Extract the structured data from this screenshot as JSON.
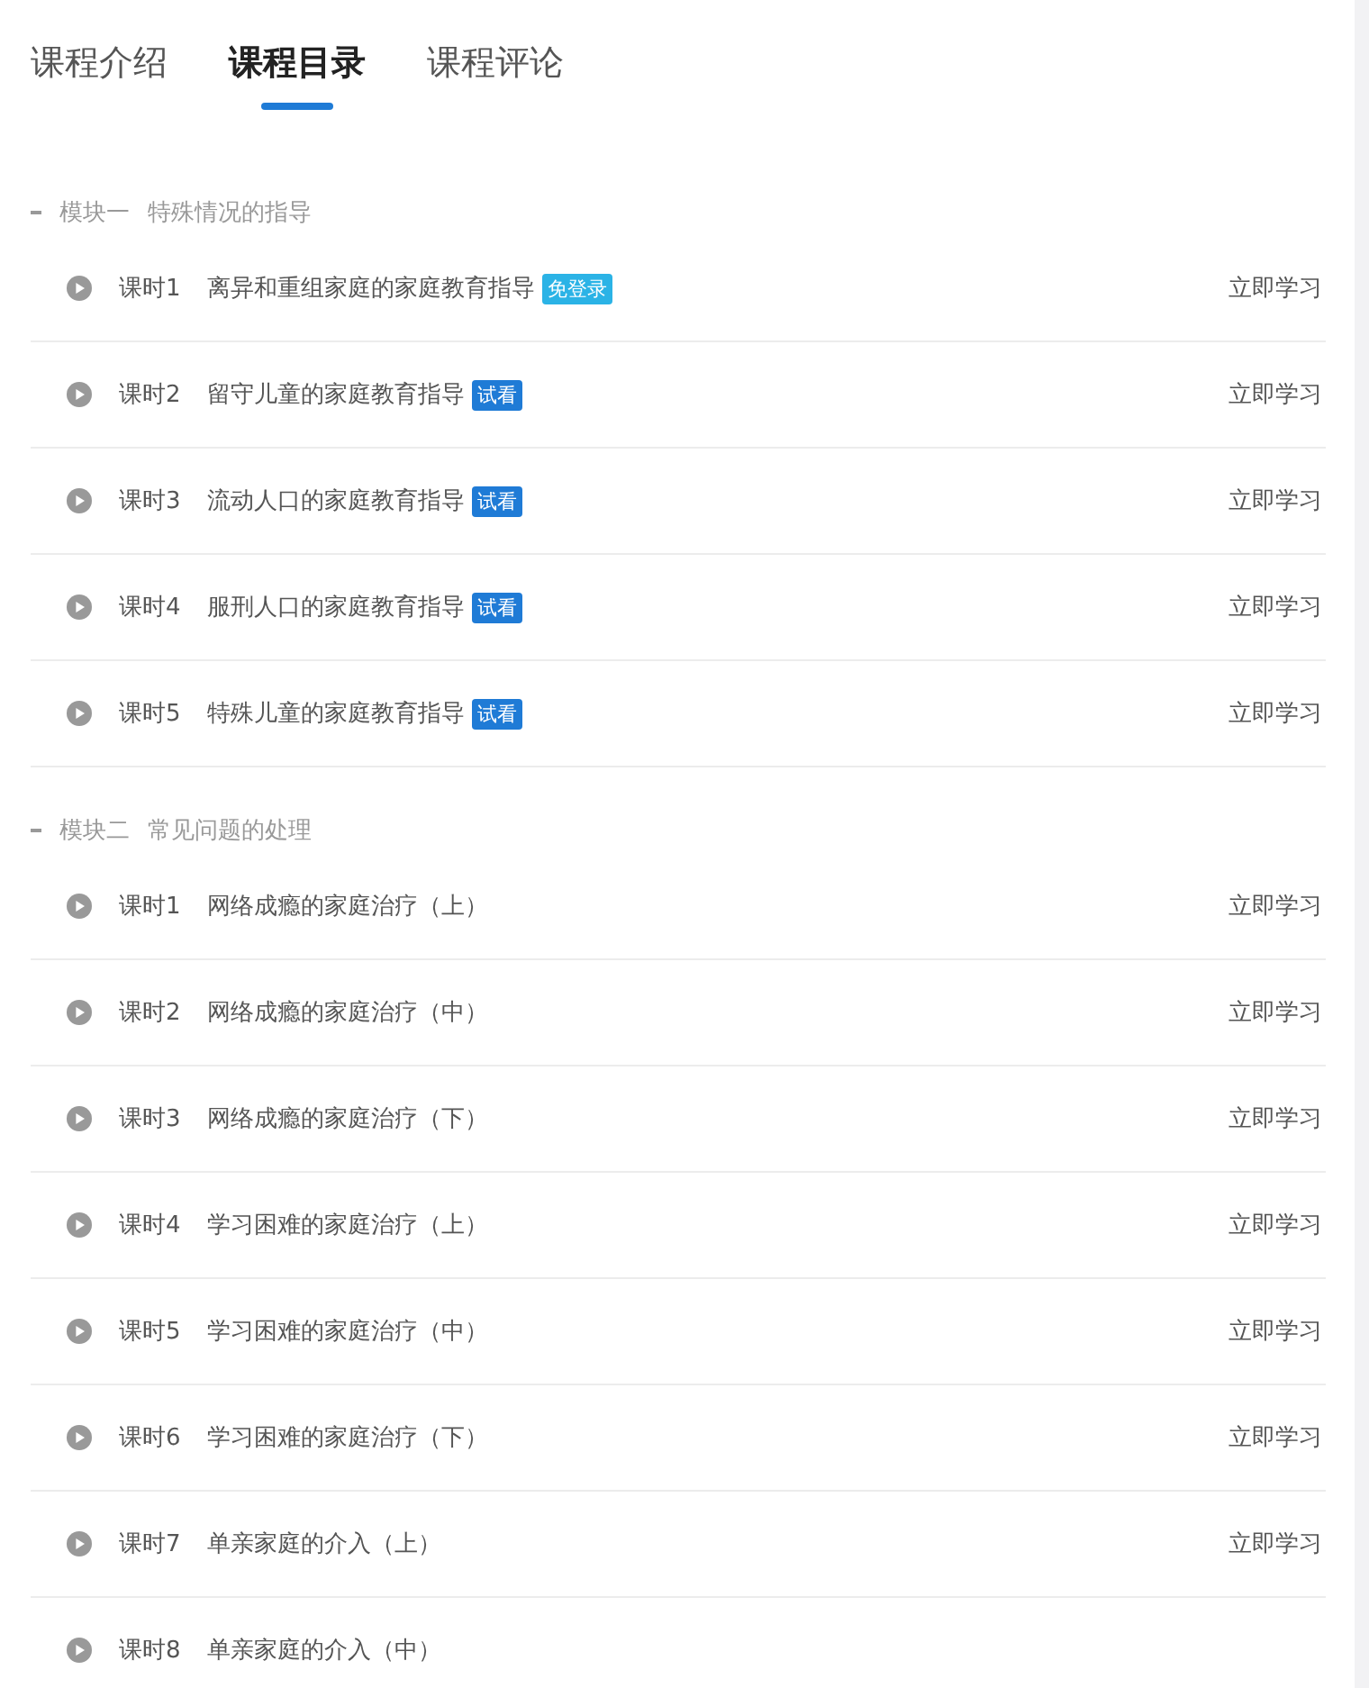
{
  "tabs": [
    {
      "label": "课程介绍",
      "selected": false
    },
    {
      "label": "课程目录",
      "selected": true
    },
    {
      "label": "课程评论",
      "selected": false
    }
  ],
  "modules": [
    {
      "title": "模块一",
      "subtitle": "特殊情况的指导",
      "expanded": true,
      "lessons": [
        {
          "number": "课时1",
          "title": "离异和重组家庭的家庭教育指导",
          "badge": {
            "kind": "free",
            "text": "免登录"
          },
          "action": "立即学习"
        },
        {
          "number": "课时2",
          "title": "留守儿童的家庭教育指导",
          "badge": {
            "kind": "trial",
            "text": "试看"
          },
          "action": "立即学习"
        },
        {
          "number": "课时3",
          "title": "流动人口的家庭教育指导",
          "badge": {
            "kind": "trial",
            "text": "试看"
          },
          "action": "立即学习"
        },
        {
          "number": "课时4",
          "title": "服刑人口的家庭教育指导",
          "badge": {
            "kind": "trial",
            "text": "试看"
          },
          "action": "立即学习"
        },
        {
          "number": "课时5",
          "title": "特殊儿童的家庭教育指导",
          "badge": {
            "kind": "trial",
            "text": "试看"
          },
          "action": "立即学习"
        }
      ]
    },
    {
      "title": "模块二",
      "subtitle": "常见问题的处理",
      "expanded": true,
      "lessons": [
        {
          "number": "课时1",
          "title": "网络成瘾的家庭治疗（上）",
          "action": "立即学习"
        },
        {
          "number": "课时2",
          "title": "网络成瘾的家庭治疗（中）",
          "action": "立即学习"
        },
        {
          "number": "课时3",
          "title": "网络成瘾的家庭治疗（下）",
          "action": "立即学习"
        },
        {
          "number": "课时4",
          "title": "学习困难的家庭治疗（上）",
          "action": "立即学习"
        },
        {
          "number": "课时5",
          "title": "学习困难的家庭治疗（中）",
          "action": "立即学习"
        },
        {
          "number": "课时6",
          "title": "学习困难的家庭治疗（下）",
          "action": "立即学习"
        },
        {
          "number": "课时7",
          "title": "单亲家庭的介入（上）",
          "action": "立即学习"
        },
        {
          "number": "课时8",
          "title": "单亲家庭的介入（中）"
        }
      ]
    }
  ]
}
